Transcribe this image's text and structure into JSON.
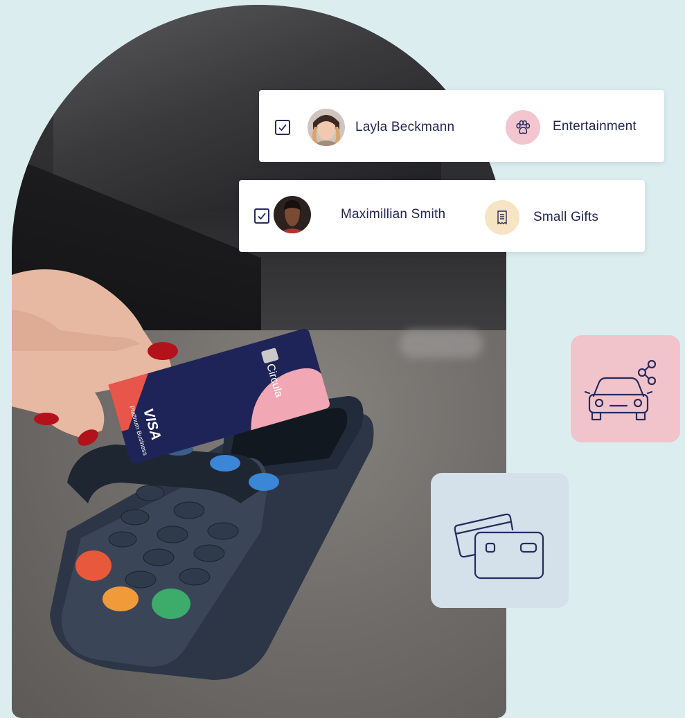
{
  "rows": [
    {
      "checked": true,
      "name": "Layla Beckmann",
      "category": "Entertainment",
      "category_icon": "paw-icon",
      "category_color": "#f3c6cf"
    },
    {
      "checked": true,
      "name": "Maximillian Smith",
      "category": "Small Gifts",
      "category_icon": "receipt-icon",
      "category_color": "#f6e4c2"
    }
  ],
  "card": {
    "brand": "Circula",
    "network": "VISA",
    "tier": "Platinum Business"
  },
  "tiles": [
    {
      "icon": "car-share-icon",
      "color": "#f1c4cc"
    },
    {
      "icon": "credit-cards-icon",
      "color": "#d4e0ea"
    }
  ],
  "colors": {
    "background": "#dcedf0",
    "ink": "#232650",
    "card_navy": "#1f2458",
    "card_pink": "#f2a7b5"
  }
}
